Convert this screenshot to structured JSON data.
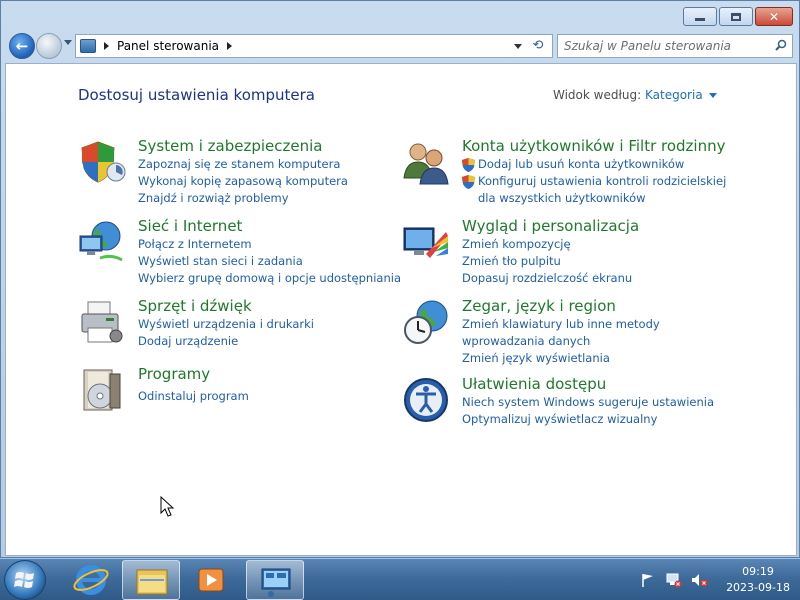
{
  "window": {
    "caption_buttons": {
      "minimize": "minimize-icon",
      "maximize": "maximize-icon",
      "close": "close-icon"
    }
  },
  "navigation": {
    "breadcrumb": [
      "Panel sterowania"
    ],
    "search_placeholder": "Szukaj w Panelu sterowania"
  },
  "header": {
    "title": "Dostosuj ustawienia komputera",
    "view_by_label": "Widok według:",
    "view_by_value": "Kategoria"
  },
  "categories": [
    {
      "title": "System i zabezpieczenia",
      "icon": "shield-icon",
      "links": [
        "Zapoznaj się ze stanem komputera",
        "Wykonaj kopię zapasową komputera",
        "Znajdź i rozwiąż problemy"
      ]
    },
    {
      "title": "Sieć i Internet",
      "icon": "network-globe-icon",
      "links": [
        "Połącz z Internetem",
        "Wyświetl stan sieci i zadania",
        "Wybierz grupę domową i opcje udostępniania"
      ]
    },
    {
      "title": "Sprzęt i dźwięk",
      "icon": "printer-icon",
      "links": [
        "Wyświetl urządzenia i drukarki",
        "Dodaj urządzenie"
      ]
    },
    {
      "title": "Programy",
      "icon": "programs-icon",
      "links": [
        "Odinstaluj program"
      ]
    },
    {
      "title": "Konta użytkowników i Filtr rodzinny",
      "icon": "users-icon",
      "links": [
        "Dodaj lub usuń konta użytkowników",
        "Konfiguruj ustawienia kontroli rodzicielskiej",
        "dla wszystkich użytkowników"
      ]
    },
    {
      "title": "Wygląd i personalizacja",
      "icon": "appearance-icon",
      "links": [
        "Zmień kompozycję",
        "Zmień tło pulpitu",
        "Dopasuj rozdzielczość ekranu"
      ]
    },
    {
      "title": "Zegar, język i region",
      "icon": "clock-globe-icon",
      "links": [
        "Zmień klawiatury lub inne metody",
        "wprowadzania danych",
        "Zmień język wyświetlania"
      ]
    },
    {
      "title": "Ułatwienia dostępu",
      "icon": "accessibility-icon",
      "links": [
        "Niech system Windows sugeruje ustawienia",
        "Optymalizuj wyświetlacz wizualny"
      ]
    }
  ],
  "taskbar": {
    "pinned": [
      "internet-explorer-icon",
      "file-explorer-icon",
      "media-player-icon",
      "control-panel-icon"
    ],
    "tray_icons": [
      "action-center-flag-icon",
      "network-icon",
      "volume-muted-icon"
    ],
    "clock_time": "09:19",
    "clock_date": "2023-09-18"
  },
  "colors": {
    "category_title": "#1e7a2b",
    "link": "#1f5ea8",
    "page_title": "#1e3287"
  }
}
